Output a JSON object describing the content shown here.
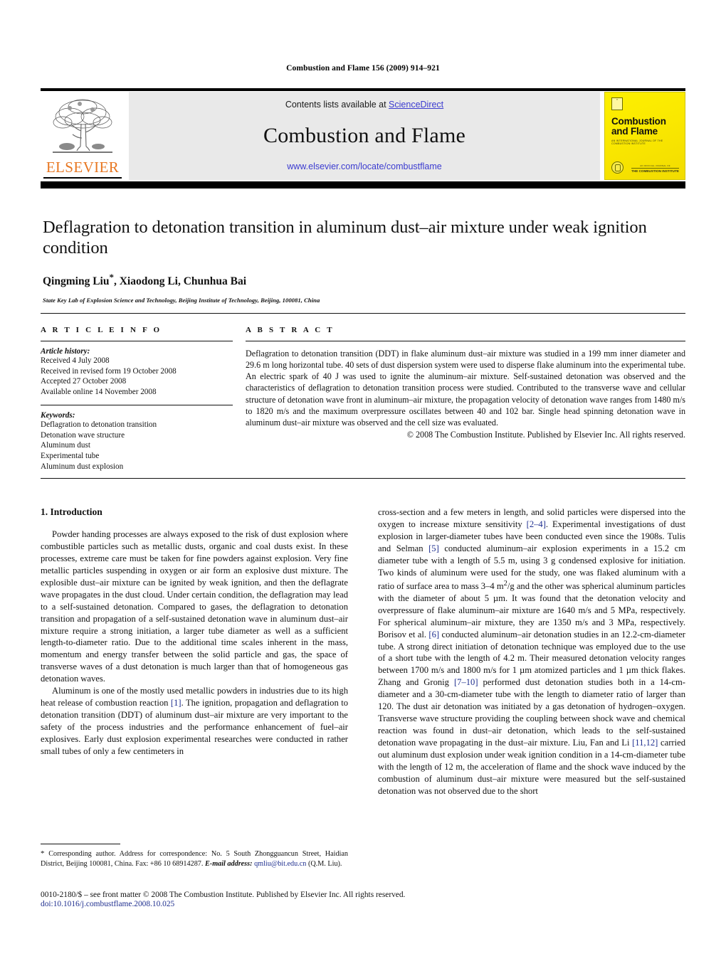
{
  "running_head": "Combustion and Flame 156 (2009) 914–921",
  "header": {
    "contents_prefix": "Contents lists available at ",
    "sciencedirect": "ScienceDirect",
    "journal_title": "Combustion and Flame",
    "journal_url": "www.elsevier.com/locate/combustflame",
    "publisher_name": "ELSEVIER",
    "publisher_logo_icon": "elsevier-tree-icon",
    "cover": {
      "title_line1": "Combustion",
      "title_line2": "and Flame",
      "subtitle": "AN INTERNATIONAL JOURNAL OF THE COMBUSTION INSTITUTE",
      "brand_line1": "AN OFFICIAL JOURNAL OF",
      "brand_line2": "THE COMBUSTION INSTITUTE",
      "seal_icon": "institute-seal-icon",
      "mini_logo_icon": "elsevier-mini-logo-icon",
      "background_color": "#fae800"
    },
    "rule_color": "#000000",
    "link_color": "#3b3bd0"
  },
  "article": {
    "title": "Deflagration to detonation transition in aluminum dust–air mixture under weak ignition condition",
    "authors": "Qingming Liu*, Xiaodong Li, Chunhua Bai",
    "authors_plain": "Qingming Liu",
    "corresponding_marker": "*",
    "authors_rest": ", Xiaodong Li, Chunhua Bai",
    "affiliation": "State Key Lab of Explosion Science and Technology, Beijing Institute of Technology, Beijing, 100081, China"
  },
  "article_info": {
    "label": "A R T I C L E   I N F O",
    "history_title": "Article history:",
    "history": [
      "Received 4 July 2008",
      "Received in revised form 19 October 2008",
      "Accepted 27 October 2008",
      "Available online 14 November 2008"
    ],
    "keywords_title": "Keywords:",
    "keywords": [
      "Deflagration to detonation transition",
      "Detonation wave structure",
      "Aluminum dust",
      "Experimental tube",
      "Aluminum dust explosion"
    ]
  },
  "abstract": {
    "label": "A B S T R A C T",
    "text": "Deflagration to detonation transition (DDT) in flake aluminum dust–air mixture was studied in a 199 mm inner diameter and 29.6 m long horizontal tube. 40 sets of dust dispersion system were used to disperse flake aluminum into the experimental tube. An electric spark of 40 J was used to ignite the aluminum–air mixture. Self-sustained detonation was observed and the characteristics of deflagration to detonation transition process were studied. Contributed to the transverse wave and cellular structure of detonation wave front in aluminum–air mixture, the propagation velocity of detonation wave ranges from 1480 m/s to 1820 m/s and the maximum overpressure oscillates between 40 and 102 bar. Single head spinning detonation wave in aluminum dust–air mixture was observed and the cell size was evaluated.",
    "copyright": "© 2008 The Combustion Institute. Published by Elsevier Inc. All rights reserved."
  },
  "body": {
    "section1_heading": "1. Introduction",
    "left_paragraph_1": "Powder handing processes are always exposed to the risk of dust explosion where combustible particles such as metallic dusts, organic and coal dusts exist. In these processes, extreme care must be taken for fine powders against explosion. Very fine metallic particles suspending in oxygen or air form an explosive dust mixture. The explosible dust–air mixture can be ignited by weak ignition, and then the deflagrate wave propagates in the dust cloud. Under certain condition, the deflagration may lead to a self-sustained detonation. Compared to gases, the deflagration to detonation transition and propagation of a self-sustained detonation wave in aluminum dust–air mixture require a strong initiation, a larger tube diameter as well as a sufficient length-to-diameter ratio. Due to the additional time scales inherent in the mass, momentum and energy transfer between the solid particle and gas, the space of transverse waves of a dust detonation is much larger than that of homogeneous gas detonation waves.",
    "left_paragraph_2_a": "Aluminum is one of the mostly used metallic powders in industries due to its high heat release of combustion reaction ",
    "left_paragraph_2_ref": "[1]",
    "left_paragraph_2_b": ". The ignition, propagation and deflagration to detonation transition (DDT) of aluminum dust–air mixture are very important to the safety of the process industries and the performance enhancement of fuel–air explosives. Early dust explosion experimental researches were conducted in rather small tubes of only a few centimeters in",
    "right_seg_1": "cross-section and a few meters in length, and solid particles were dispersed into the oxygen to increase mixture sensitivity ",
    "right_ref_1": "[2–4]",
    "right_seg_2": ". Experimental investigations of dust explosion in larger-diameter tubes have been conducted even since the 1908s. Tulis and Selman ",
    "right_ref_2": "[5]",
    "right_seg_3": " conducted aluminum–air explosion experiments in a 15.2 cm diameter tube with a length of 5.5 m, using 3 g condensed explosive for initiation. Two kinds of aluminum were used for the study, one was flaked aluminum with a ratio of surface area to mass 3–4 m",
    "right_sup_1": "2",
    "right_seg_4": "/g and the other was spherical aluminum particles with the diameter of about 5 µm. It was found that the detonation velocity and overpressure of flake aluminum–air mixture are 1640 m/s and 5 MPa, respectively. For spherical aluminum–air mixture, they are 1350 m/s and 3 MPa, respectively. Borisov et al. ",
    "right_ref_3": "[6]",
    "right_seg_5": " conducted aluminum–air detonation studies in an 12.2-cm-diameter tube. A strong direct initiation of detonation technique was employed due to the use of a short tube with the length of 4.2 m. Their measured detonation velocity ranges between 1700 m/s and 1800 m/s for 1 µm atomized particles and 1 µm thick flakes. Zhang and Gronig ",
    "right_ref_4": "[7–10]",
    "right_seg_6": " performed dust detonation studies both in a 14-cm-diameter and a 30-cm-diameter tube with the length to diameter ratio of larger than 120. The dust air detonation was initiated by a gas detonation of hydrogen–oxygen. Transverse wave structure providing the coupling between shock wave and chemical reaction was found in dust–air detonation, which leads to the self-sustained detonation wave propagating in the dust–air mixture. Liu, Fan and Li ",
    "right_ref_5": "[11,12]",
    "right_seg_7": " carried out aluminum dust explosion under weak ignition condition in a 14-cm-diameter tube with the length of 12 m, the acceleration of flame and the shock wave induced by the combustion of aluminum dust–air mixture were measured but the self-sustained detonation was not observed due to the short"
  },
  "footnote": {
    "star": "*",
    "text": " Corresponding author. Address for correspondence: No. 5 South Zhongguancun Street, Haidian District, Beijing 100081, China. Fax: +86 10 68914287.",
    "email_label": "E-mail address:",
    "email": "qmliu@bit.edu.cn",
    "email_suffix": " (Q.M. Liu)."
  },
  "footer": {
    "front_matter": "0010-2180/$ – see front matter © 2008 The Combustion Institute. Published by Elsevier Inc. All rights reserved.",
    "doi": "doi:10.1016/j.combustflame.2008.10.025"
  }
}
